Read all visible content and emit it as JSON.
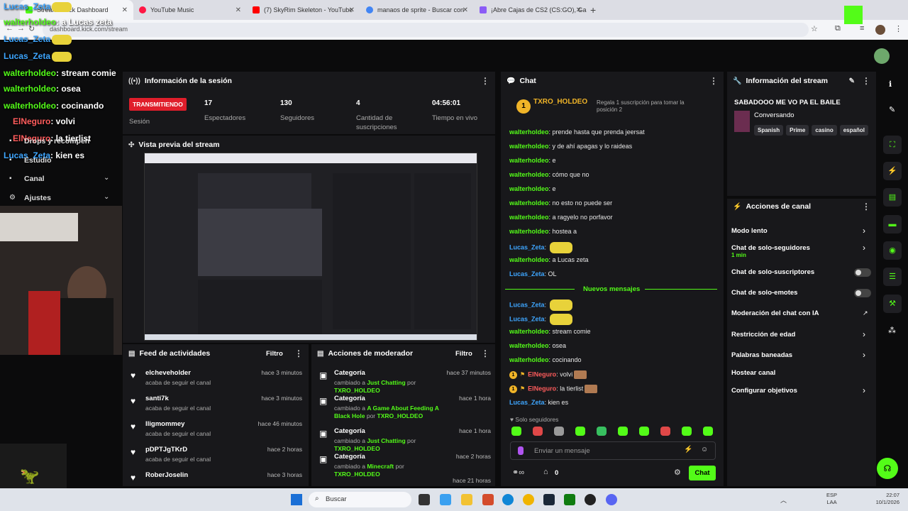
{
  "browser": {
    "tabs": [
      {
        "label": "Stream - Kick Dashboard",
        "color": "#53fc18"
      },
      {
        "label": "YouTube Music",
        "color": "#ff1744"
      },
      {
        "label": "(7) SkyRim Skeleton - YouTube",
        "color": "#ff0000"
      },
      {
        "label": "manaos de sprite - Buscar con",
        "color": "#4285f4"
      },
      {
        "label": "¡Abre Cajas de CS2 (CS:GO), Ga",
        "color": "#8b5cf6"
      }
    ],
    "new_tab": "+",
    "url": "dashboard.kick.com/stream"
  },
  "session": {
    "title": "Información de la sesión",
    "live_label": "TRANSMITIENDO",
    "session_label": "Sesión",
    "stats": [
      {
        "value": "17",
        "label": "Espectadores"
      },
      {
        "value": "130",
        "label": "Seguidores"
      },
      {
        "value": "4",
        "label": "Cantidad de suscripciones"
      },
      {
        "value": "04:56:01",
        "label": "Tiempo en vivo"
      }
    ]
  },
  "preview": {
    "title": "Vista previa del stream"
  },
  "followers": {
    "title": "Feed de actividades",
    "filter": "Filtro",
    "items": [
      {
        "name": "elcheveholder",
        "sub": "acaba de seguir el canal",
        "time": "hace 3 minutos"
      },
      {
        "name": "santi7k",
        "sub": "acaba de seguir el canal",
        "time": "hace 3 minutos"
      },
      {
        "name": "lligmommey",
        "sub": "acaba de seguir el canal",
        "time": "hace 46 minutos"
      },
      {
        "name": "pDPTJgTKrD",
        "sub": "acaba de seguir el canal",
        "time": "hace 2 horas"
      },
      {
        "name": "RoberJoselin",
        "sub": "",
        "time": "hace 3 horas"
      }
    ]
  },
  "modactions": {
    "title": "Acciones de moderador",
    "filter": "Filtro",
    "items": [
      {
        "title": "Categoría",
        "pre": "cambiado a",
        "cat": "Just Chatting",
        "by": "por",
        "user": "TXRO_HOLDEO",
        "time": "hace 37 minutos"
      },
      {
        "title": "Categoría",
        "pre": "cambiado a",
        "cat": "A Game About Feeding A Black Hole",
        "by": "por",
        "user": "TXRO_HOLDEO",
        "time": "hace 1 hora"
      },
      {
        "title": "Categoría",
        "pre": "cambiado a",
        "cat": "Just Chatting",
        "by": "por",
        "user": "TXRO_HOLDEO",
        "time": "hace 1 hora"
      },
      {
        "title": "Categoría",
        "pre": "cambiado a",
        "cat": "Minecraft",
        "by": "por",
        "user": "TXRO_HOLDEO",
        "time": "hace 2 horas"
      },
      {
        "title": "",
        "pre": "",
        "cat": "",
        "by": "",
        "user": "",
        "time": "hace 21 horas"
      }
    ]
  },
  "chat": {
    "title": "Chat",
    "pinned_user": "TXRO_HOLDEO",
    "pinned_count": "1",
    "gift_text": "Regala 1 suscripción para tomar la posición 2",
    "messages": [
      {
        "user": "walterholdeo",
        "text": "prende hasta que prenda jeersat",
        "kind": "w"
      },
      {
        "user": "walterholdeo",
        "text": "y de ahí apagas y lo raideas",
        "kind": "w"
      },
      {
        "user": "walterholdeo",
        "text": "e",
        "kind": "w"
      },
      {
        "user": "walterholdeo",
        "text": "cómo que no",
        "kind": "w"
      },
      {
        "user": "walterholdeo",
        "text": "e",
        "kind": "w"
      },
      {
        "user": "walterholdeo",
        "text": "no esto no puede ser",
        "kind": "w"
      },
      {
        "user": "walterholdeo",
        "text": "a ragyelo no porfavor",
        "kind": "w"
      },
      {
        "user": "walterholdeo",
        "text": "hostea a",
        "kind": "w"
      },
      {
        "user": "Lucas_Zeta",
        "text": "",
        "kind": "l"
      },
      {
        "user": "walterholdeo",
        "text": "a Lucas zeta",
        "kind": "w"
      },
      {
        "user": "Lucas_Zeta",
        "text": "OL",
        "kind": "l"
      }
    ],
    "new_label": "Nuevos mensajes",
    "new_messages": [
      {
        "user": "Lucas_Zeta",
        "text": "",
        "kind": "l"
      },
      {
        "user": "Lucas_Zeta",
        "text": "",
        "kind": "l"
      },
      {
        "user": "walterholdeo",
        "text": "stream comie",
        "kind": "w"
      },
      {
        "user": "walterholdeo",
        "text": "osea",
        "kind": "w"
      },
      {
        "user": "walterholdeo",
        "text": "cocinando",
        "kind": "w"
      },
      {
        "user": "ElNeguro",
        "text": "volvi",
        "kind": "e"
      },
      {
        "user": "ElNeguro",
        "text": "la tierlist",
        "kind": "e"
      },
      {
        "user": "Lucas_Zeta",
        "text": "kien es",
        "kind": "l"
      }
    ],
    "followers_only": "Solo seguidores",
    "input_placeholder": "Enviar un mensaje",
    "counter": "0",
    "send_label": "Chat"
  },
  "stream_info": {
    "title": "Información del stream",
    "stream_title": "SABADOOO ME VO PA EL BAILE",
    "category": "Conversando",
    "tags": [
      "Spanish",
      "Prime",
      "casino",
      "español"
    ]
  },
  "channel_actions": {
    "title": "Acciones de canal",
    "items": [
      {
        "label": "Modo lento",
        "sub": "",
        "control": "chevron"
      },
      {
        "label": "Chat de solo-seguidores",
        "sub": "1 min",
        "control": "chevron"
      },
      {
        "label": "Chat de solo-suscriptores",
        "sub": "",
        "control": "toggle"
      },
      {
        "label": "Chat de solo-emotes",
        "sub": "",
        "control": "toggle"
      },
      {
        "label": "Moderación del chat con IA",
        "sub": "",
        "control": "external"
      },
      {
        "label": "Restricción de edad",
        "sub": "",
        "control": "chevron"
      },
      {
        "label": "Palabras baneadas",
        "sub": "",
        "control": "chevron"
      },
      {
        "label": "Hostear canal",
        "sub": "",
        "control": "none"
      },
      {
        "label": "Configurar objetivos",
        "sub": "",
        "control": "chevron"
      }
    ]
  },
  "overlay": {
    "lines": [
      {
        "user": "Lucas_Zeta",
        "text": "",
        "kind": "l"
      },
      {
        "user": "walterholdeo",
        "text": ": a Lucas zeta",
        "kind": "w"
      },
      {
        "user": "Lucas_Zeta",
        "text": "",
        "kind": "l"
      },
      {
        "user": "Lucas_Zeta",
        "text": "",
        "kind": "l"
      },
      {
        "user": "walterholdeo",
        "text": ": stream comie",
        "kind": "w"
      },
      {
        "user": "walterholdeo",
        "text": ": osea",
        "kind": "w"
      },
      {
        "user": "walterholdeo",
        "text": ": cocinando",
        "kind": "w"
      },
      {
        "user": "ElNeguro",
        "text": ": volvi",
        "kind": "e"
      },
      {
        "user": "ElNeguro",
        "text": ": la tierlist",
        "kind": "e"
      },
      {
        "user": "Lucas_Zeta",
        "text": ": kien es",
        "kind": "l"
      }
    ],
    "menu": [
      "Drops y recompen",
      "Estudio",
      "Canal",
      "Ajustes"
    ]
  },
  "taskbar": {
    "search": "Buscar",
    "lang": "ESP",
    "lang2": "LAA",
    "time": "22:07",
    "date": "10/1/2026"
  }
}
